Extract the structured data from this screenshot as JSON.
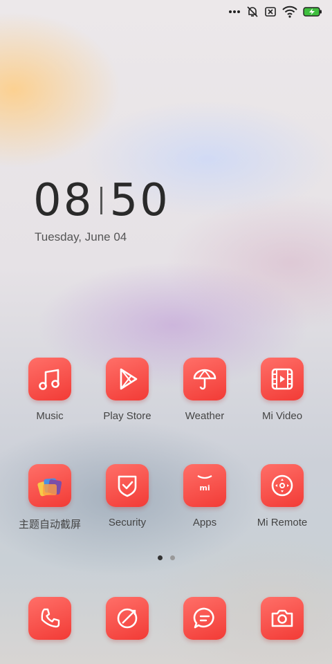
{
  "status_bar": {
    "icons": [
      "more-dots-icon",
      "mute-icon",
      "no-sim-icon",
      "wifi-icon",
      "battery-charging-icon"
    ]
  },
  "clock": {
    "hours": "08",
    "minutes": "50",
    "date": "Tuesday, June 04"
  },
  "apps_row1": [
    {
      "label": "Music",
      "icon": "music-note-icon"
    },
    {
      "label": "Play Store",
      "icon": "play-store-icon"
    },
    {
      "label": "Weather",
      "icon": "umbrella-icon"
    },
    {
      "label": "Mi Video",
      "icon": "film-icon"
    }
  ],
  "apps_row2": [
    {
      "label": "主题自动截屏",
      "icon": "theme-screenshot-icon"
    },
    {
      "label": "Security",
      "icon": "shield-check-icon"
    },
    {
      "label": "Apps",
      "icon": "mi-apps-icon"
    },
    {
      "label": "Mi Remote",
      "icon": "remote-icon"
    }
  ],
  "dock": [
    {
      "icon": "phone-icon"
    },
    {
      "icon": "browser-icon"
    },
    {
      "icon": "messages-icon"
    },
    {
      "icon": "camera-icon"
    }
  ],
  "pagination": {
    "pages": 2,
    "current": 1
  },
  "colors": {
    "icon_red": "#f23b36",
    "icon_red_light": "#ff6f68",
    "text": "#444444"
  }
}
